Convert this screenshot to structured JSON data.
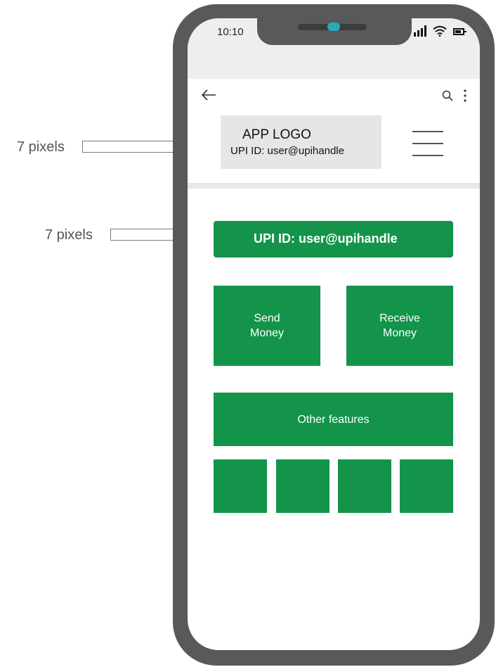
{
  "annotations": {
    "top_label": "7 pixels",
    "bottom_label": "7 pixels"
  },
  "status_bar": {
    "time": "10:10",
    "icons": [
      "signal-icon",
      "wifi-icon",
      "battery-icon"
    ]
  },
  "app_bar": {
    "icons": [
      "back-arrow-icon",
      "search-icon",
      "more-options-icon"
    ]
  },
  "header": {
    "logo_text": "APP LOGO",
    "upi_id": "UPI ID: user@upihandle",
    "menu_icon": "hamburger-menu-icon"
  },
  "main": {
    "upi_bar_text": "UPI ID: user@upihandle",
    "send_money": "Send\nMoney",
    "receive_money": "Receive\nMoney",
    "other_features": "Other features",
    "feature_tiles_count": 4
  },
  "colors": {
    "accent": "#13944a",
    "phone_frame": "#58595b",
    "notch_camera": "#29a9b8",
    "logo_box": "#e6e6e6"
  }
}
